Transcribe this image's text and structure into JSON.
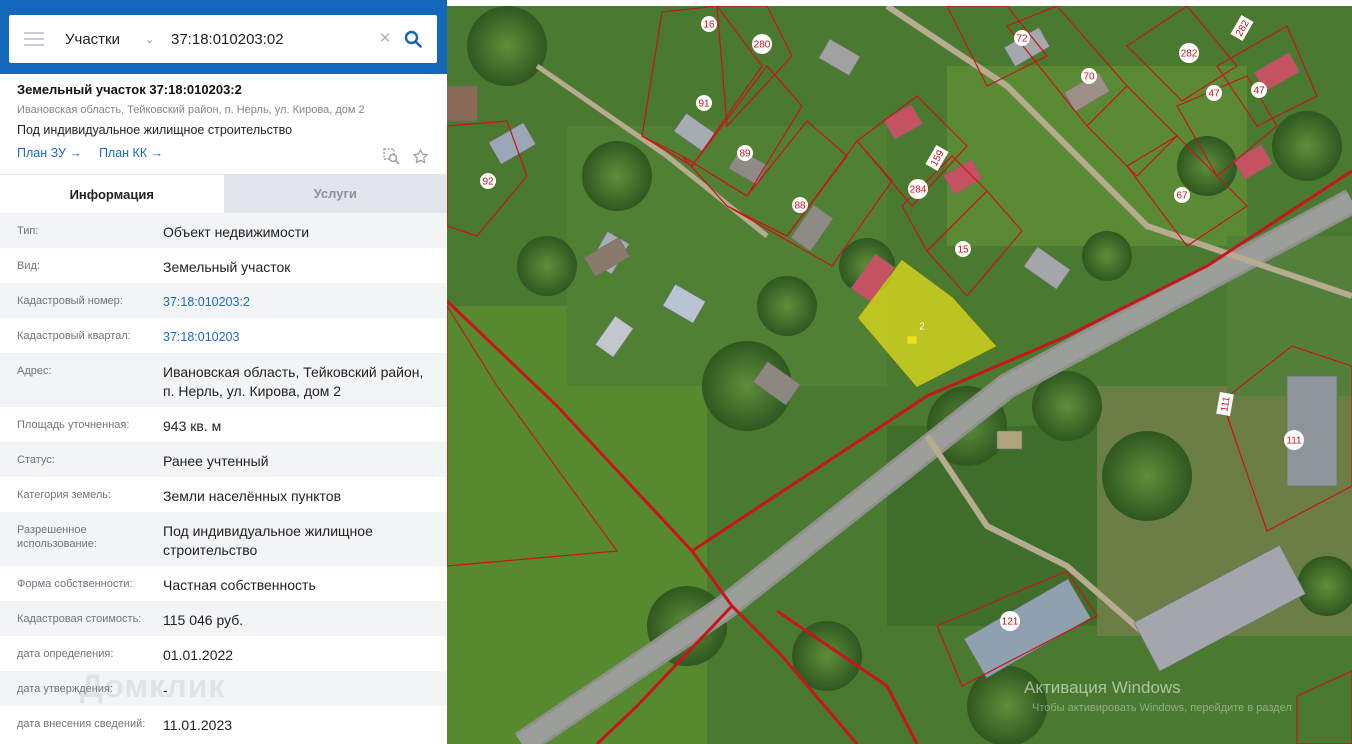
{
  "search": {
    "layer": "Участки",
    "query": "37:18:010203:02"
  },
  "card": {
    "title": "Земельный участок 37:18:010203:2",
    "address": "Ивановская область, Тейковский район, п. Нерль, ул. Кирова, дом 2",
    "purpose": "Под индивидуальное жилищное строительство",
    "link_plan_zu": "План ЗУ →",
    "link_plan_kk": "План КК →"
  },
  "tabs": {
    "info": "Информация",
    "services": "Услуги"
  },
  "rows": [
    {
      "label": "Тип:",
      "value": "Объект недвижимости"
    },
    {
      "label": "Вид:",
      "value": "Земельный участок"
    },
    {
      "label": "Кадастровый номер:",
      "value": "37:18:010203:2"
    },
    {
      "label": "Кадастровый квартал:",
      "value": "37:18:010203"
    },
    {
      "label": "Адрес:",
      "value": "Ивановская область, Тейковский район, п. Нерль, ул. Кирова, дом 2"
    },
    {
      "label": "Площадь уточненная:",
      "value": "943 кв. м"
    },
    {
      "label": "Статус:",
      "value": "Ранее учтенный"
    },
    {
      "label": "Категория земель:",
      "value": "Земли населённых пунктов"
    },
    {
      "label": "Разрешенное использование:",
      "value": "Под индивидуальное жилищное строительство"
    },
    {
      "label": "Форма собственности:",
      "value": "Частная собственность"
    },
    {
      "label": "Кадастровая стоимость:",
      "value": "115 046 руб."
    },
    {
      "label": "дата определения:",
      "value": "01.01.2022"
    },
    {
      "label": "дата утверждения:",
      "value": "-"
    },
    {
      "label": "дата внесения сведений:",
      "value": "11.01.2023"
    }
  ],
  "watermark": "Домклик",
  "windows_activation": {
    "title": "Активация Windows",
    "subtitle": "Чтобы активировать Windows, перейдите в раздел"
  },
  "map_labels": {
    "l16": "16",
    "l280": "280",
    "l72": "72",
    "l70": "70",
    "l282": "282",
    "l282b": "282",
    "l91": "91",
    "l89": "89",
    "l92": "92",
    "l159": "159",
    "l284": "284",
    "l88": "88",
    "l15": "15",
    "l47a": "47",
    "l47b": "47",
    "l67": "67",
    "l2": "2",
    "l111a": "111",
    "l111b": "111",
    "l121": "121"
  },
  "colors": {
    "header_blue": "#1467b8",
    "link_blue": "#1a6cc4",
    "parcel_red": "#c8141a",
    "selected_parcel": "#e8e01a"
  }
}
